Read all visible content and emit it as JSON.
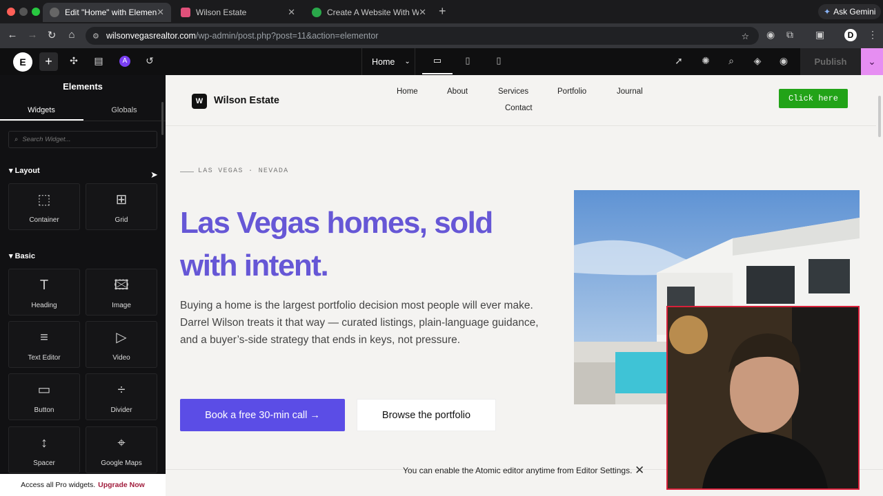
{
  "browser": {
    "tabs": [
      {
        "label": "Edit \"Home\" with Elementor",
        "active": true
      },
      {
        "label": "Wilson Estate",
        "active": false
      },
      {
        "label": "Create A Website With WordP",
        "active": false
      }
    ],
    "ask_gemini": "Ask Gemini",
    "url_host": "wilsonvegasrealtor.com",
    "url_path": "/wp-admin/post.php?post=11&action=elementor",
    "profile_initial": "D"
  },
  "editor": {
    "logo": "E",
    "page_selector": "Home",
    "publish_label": "Publish"
  },
  "panel": {
    "title": "Elements",
    "tabs": [
      "Widgets",
      "Globals"
    ],
    "search_placeholder": "Search Widget...",
    "sections": {
      "layout": "Layout",
      "basic": "Basic"
    },
    "layout_widgets": [
      "Container",
      "Grid"
    ],
    "basic_widgets": [
      "Heading",
      "Image",
      "Text Editor",
      "Video",
      "Button",
      "Divider",
      "Spacer",
      "Google Maps"
    ],
    "pro_text": "Access all Pro widgets.",
    "upgrade_label": "Upgrade Now"
  },
  "site": {
    "logo_letter": "W",
    "brand": "Wilson Estate",
    "nav": [
      "Home",
      "About",
      "Services",
      "Portfolio",
      "Journal",
      "Contact"
    ],
    "cta": "Click here",
    "eyebrow": "LAS VEGAS · NEVADA",
    "hero_title": "Las Vegas homes, sold with intent.",
    "hero_body": "Buying a home is the largest portfolio decision most people will ever make. Darrel Wilson treats it that way — curated listings, plain-language guidance, and a buyer’s-side strategy that ends in keys, not pressure.",
    "primary_button": "Book a free 30-min call →",
    "secondary_button": "Browse the portfolio"
  },
  "toast": {
    "message": "You can enable the Atomic editor anytime from Editor Settings."
  },
  "colors": {
    "accent_purple": "#6657d6",
    "primary_button": "#5b4de6",
    "cta_green": "#22a318",
    "publish_pink": "#e68ef2",
    "upgrade_red": "#a11c3c"
  }
}
